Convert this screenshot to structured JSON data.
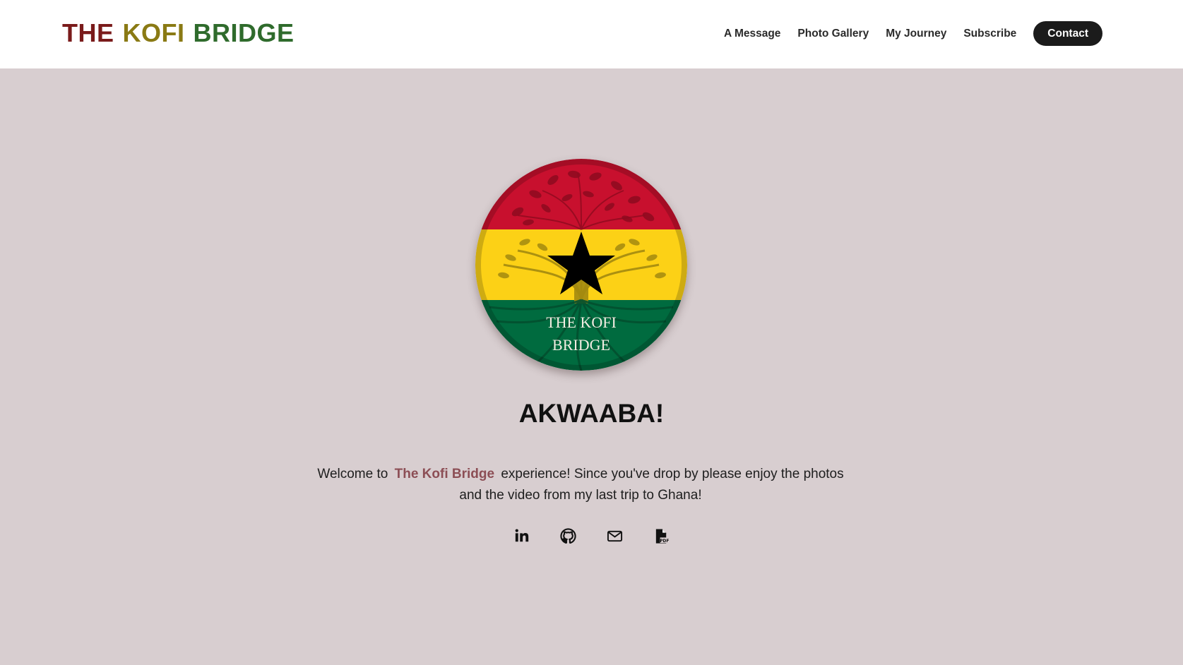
{
  "header": {
    "logo": {
      "word1": "THE",
      "word2": "KOFI",
      "word3": "BRIDGE",
      "colors": {
        "word1": "#7a1b1b",
        "word2": "#8a7a14",
        "word3": "#2f6b2c"
      }
    },
    "nav": {
      "items": [
        {
          "label": "A Message"
        },
        {
          "label": "Photo Gallery"
        },
        {
          "label": "My Journey"
        },
        {
          "label": "Subscribe"
        }
      ],
      "contact_label": "Contact"
    }
  },
  "hero": {
    "background_color": "#d8ced0",
    "emblem": {
      "text_line1": "THE KOFI",
      "text_line2": "BRIDGE",
      "colors": {
        "red": "#c8102e",
        "yellow": "#fcd116",
        "green": "#006b3f",
        "star": "#000000"
      }
    },
    "greeting": "AKWAABA!",
    "welcome": {
      "before": "Welcome to",
      "brand": "The Kofi Bridge",
      "after": "experience! Since you've drop by please enjoy the photos and the video from my last trip to Ghana!",
      "brand_color": "#8c4e55"
    },
    "socials": [
      {
        "icon": "linkedin-icon"
      },
      {
        "icon": "github-icon"
      },
      {
        "icon": "mail-icon"
      },
      {
        "icon": "pdf-icon"
      }
    ]
  }
}
